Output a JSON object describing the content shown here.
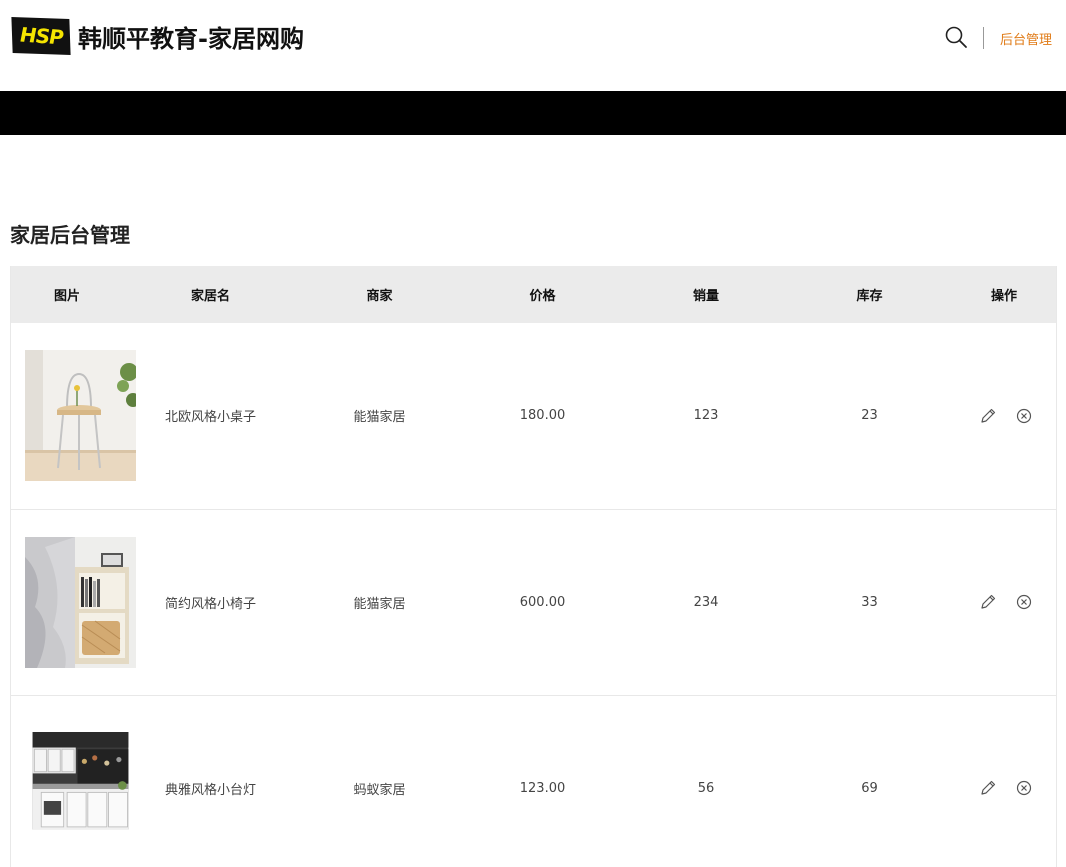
{
  "brand": {
    "badge": "HSP",
    "title": "韩顺平教育-家居网购"
  },
  "nav": {
    "admin_label": "后台管理"
  },
  "page": {
    "title": "家居后台管理"
  },
  "table": {
    "headers": [
      "图片",
      "家居名",
      "商家",
      "价格",
      "销量",
      "库存",
      "操作"
    ],
    "rows": [
      {
        "name": "北欧风格小桌子",
        "merchant": "能猫家居",
        "price": "180.00",
        "sales": "123",
        "stock": "23"
      },
      {
        "name": "简约风格小椅子",
        "merchant": "能猫家居",
        "price": "600.00",
        "sales": "234",
        "stock": "33"
      },
      {
        "name": "典雅风格小台灯",
        "merchant": "蚂蚁家居",
        "price": "123.00",
        "sales": "56",
        "stock": "69"
      }
    ]
  },
  "icons": {
    "search": "search-icon",
    "edit": "pencil-icon",
    "delete": "circle-x-icon"
  },
  "colors": {
    "accent": "#e07b17",
    "header_bar": "#000000",
    "logo_yellow": "#f5e400",
    "table_head_bg": "#ebebeb"
  }
}
